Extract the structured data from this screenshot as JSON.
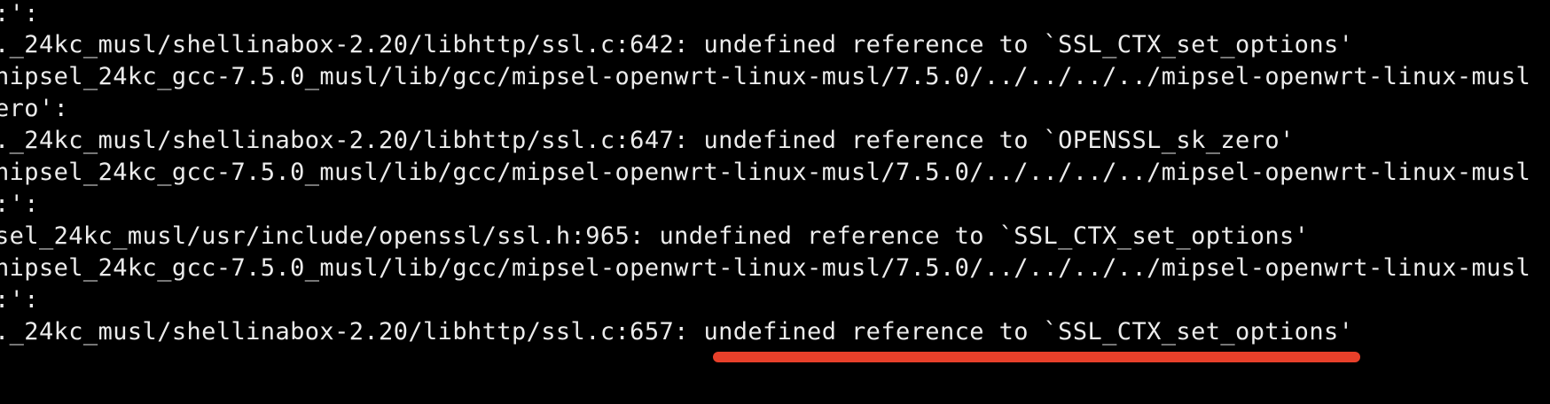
{
  "terminal": {
    "lines": [
      ":':",
      "._24kc_musl/shellinabox-2.20/libhttp/ssl.c:642: undefined reference to `SSL_CTX_set_options'",
      "nipsel_24kc_gcc-7.5.0_musl/lib/gcc/mipsel-openwrt-linux-musl/7.5.0/../../../../mipsel-openwrt-linux-musl",
      "ero':",
      "._24kc_musl/shellinabox-2.20/libhttp/ssl.c:647: undefined reference to `OPENSSL_sk_zero'",
      "nipsel_24kc_gcc-7.5.0_musl/lib/gcc/mipsel-openwrt-linux-musl/7.5.0/../../../../mipsel-openwrt-linux-musl",
      ":':",
      "sel_24kc_musl/usr/include/openssl/ssl.h:965: undefined reference to `SSL_CTX_set_options'",
      "nipsel_24kc_gcc-7.5.0_musl/lib/gcc/mipsel-openwrt-linux-musl/7.5.0/../../../../mipsel-openwrt-linux-musl",
      ":':",
      "._24kc_musl/shellinabox-2.20/libhttp/ssl.c:657: undefined reference to `SSL_CTX_set_options'"
    ]
  },
  "colors": {
    "background": "#000000",
    "text": "#ececec",
    "highlight_underline": "#e8402a"
  }
}
